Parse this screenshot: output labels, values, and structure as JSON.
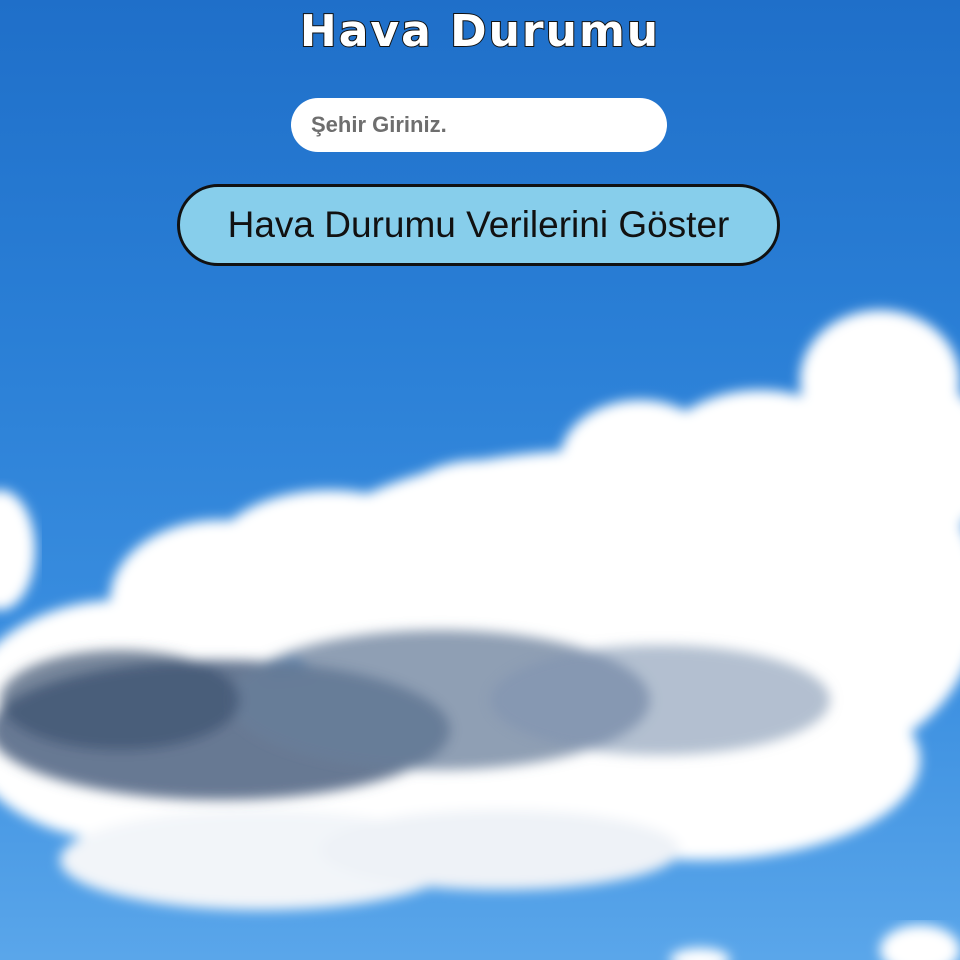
{
  "page": {
    "title": "Hava Durumu"
  },
  "search": {
    "placeholder": "Şehir Giriniz.",
    "value": ""
  },
  "actions": {
    "show_weather_label": "Hava Durumu Verilerini Göster"
  },
  "colors": {
    "sky_top": "#1f6fc9",
    "sky_bottom": "#5aa6ea",
    "button_background": "#87ceeb",
    "button_border": "#111111",
    "title_text": "#ffffff",
    "title_outline": "#111111",
    "cloud": "#ffffff",
    "cloud_shadow": "#5b6f8c"
  },
  "background": {
    "scene": "sky-with-clouds"
  }
}
